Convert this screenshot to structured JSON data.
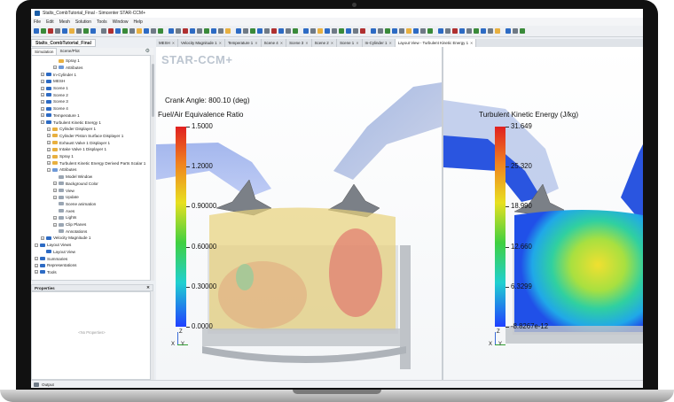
{
  "window": {
    "title": "Stalts_CombTutorial_Final - Simcenter STAR-CCM+"
  },
  "menu": [
    "File",
    "Edit",
    "Mesh",
    "Solution",
    "Tools",
    "Window",
    "Help"
  ],
  "left_panel": {
    "tabs": [
      "Stalts_CombTutorial_Final"
    ],
    "subtabs": [
      "Simulation",
      "Scene/Plot"
    ],
    "tree": [
      {
        "label": "Spray 1",
        "depth": 2,
        "exp": "",
        "icon": "#e8b040"
      },
      {
        "label": "Attributes",
        "depth": 2,
        "exp": "+",
        "icon": "#6f9ad8"
      },
      {
        "label": "In-Cylinder 1",
        "depth": 0,
        "exp": "+",
        "icon": "#2d6bc4"
      },
      {
        "label": "MESH",
        "depth": 0,
        "exp": "+",
        "icon": "#2d6bc4"
      },
      {
        "label": "Scene 1",
        "depth": 0,
        "exp": "+",
        "icon": "#2d6bc4"
      },
      {
        "label": "Scene 2",
        "depth": 0,
        "exp": "+",
        "icon": "#2d6bc4"
      },
      {
        "label": "Scene 3",
        "depth": 0,
        "exp": "+",
        "icon": "#2d6bc4"
      },
      {
        "label": "Scene 4",
        "depth": 0,
        "exp": "+",
        "icon": "#2d6bc4"
      },
      {
        "label": "Temperature 1",
        "depth": 0,
        "exp": "+",
        "icon": "#2d6bc4"
      },
      {
        "label": "Turbulent Kinetic Energy 1",
        "depth": 0,
        "exp": "−",
        "icon": "#2d6bc4"
      },
      {
        "label": "Cylinder Displayer 1",
        "depth": 1,
        "exp": "+",
        "icon": "#e8b040"
      },
      {
        "label": "Cylinder Piston Surface Displayer 1",
        "depth": 1,
        "exp": "+",
        "icon": "#e8b040"
      },
      {
        "label": "Exhaust Valve 1 Displayer 1",
        "depth": 1,
        "exp": "+",
        "icon": "#e8b040"
      },
      {
        "label": "Intake Valve 1 Displayer 1",
        "depth": 1,
        "exp": "+",
        "icon": "#e8b040"
      },
      {
        "label": "Spray 1",
        "depth": 1,
        "exp": "+",
        "icon": "#e8b040"
      },
      {
        "label": "Turbulent Kinetic Energy Derived Parts Scalar 1",
        "depth": 1,
        "exp": "+",
        "icon": "#e8b040"
      },
      {
        "label": "Attributes",
        "depth": 1,
        "exp": "−",
        "icon": "#6f9ad8"
      },
      {
        "label": "Model Window",
        "depth": 2,
        "exp": "",
        "icon": "#9aa6b3"
      },
      {
        "label": "Background Color",
        "depth": 2,
        "exp": "+",
        "icon": "#9aa6b3"
      },
      {
        "label": "View",
        "depth": 2,
        "exp": "+",
        "icon": "#9aa6b3"
      },
      {
        "label": "Update",
        "depth": 2,
        "exp": "+",
        "icon": "#9aa6b3"
      },
      {
        "label": "Scene animation",
        "depth": 2,
        "exp": "",
        "icon": "#9aa6b3"
      },
      {
        "label": "Axes",
        "depth": 2,
        "exp": "",
        "icon": "#9aa6b3"
      },
      {
        "label": "Lights",
        "depth": 2,
        "exp": "+",
        "icon": "#9aa6b3"
      },
      {
        "label": "Clip Planes",
        "depth": 2,
        "exp": "+",
        "icon": "#9aa6b3"
      },
      {
        "label": "Annotations",
        "depth": 2,
        "exp": "",
        "icon": "#9aa6b3"
      },
      {
        "label": "Velocity Magnitude 1",
        "depth": 0,
        "exp": "+",
        "icon": "#2d6bc4"
      },
      {
        "label": "Layout Views",
        "depth": -1,
        "exp": "−",
        "icon": "#2d6bc4"
      },
      {
        "label": "Layout View",
        "depth": 0,
        "exp": "",
        "icon": "#2d6bc4"
      },
      {
        "label": "Summaries",
        "depth": -1,
        "exp": "+",
        "icon": "#2d6bc4"
      },
      {
        "label": "Representations",
        "depth": -1,
        "exp": "+",
        "icon": "#2d6bc4"
      },
      {
        "label": "Tools",
        "depth": -1,
        "exp": "+",
        "icon": "#2d6bc4"
      }
    ],
    "properties": {
      "title": "Properties",
      "empty_text": "<No Properties>"
    }
  },
  "doc_tabs": [
    {
      "label": "MESH",
      "active": false
    },
    {
      "label": "Velocity Magnitude 1",
      "active": false
    },
    {
      "label": "Temperature 1",
      "active": false
    },
    {
      "label": "Scene 4",
      "active": false
    },
    {
      "label": "Scene 3",
      "active": false
    },
    {
      "label": "Scene 2",
      "active": false
    },
    {
      "label": "Scene 1",
      "active": false
    },
    {
      "label": "In-Cylinder 1",
      "active": false
    },
    {
      "label": "Layout View - Turbulent Kinetic Energy 1",
      "active": true
    }
  ],
  "viewports": {
    "left": {
      "logo": "STAR-CCM+",
      "crank_angle": "Crank Angle:  800.10 (deg)",
      "colorbar_title": "Fuel/Air Equivalence Ratio",
      "colorbar_labels": [
        "1.5000",
        "1.2000",
        "0.90000",
        "0.60000",
        "0.30000",
        "0.0000"
      ]
    },
    "right": {
      "colorbar_title": "Turbulent Kinetic Energy (J/kg)",
      "colorbar_labels": [
        "31.649",
        "25.320",
        "18.990",
        "12.660",
        "6.3299",
        "-8.8267e-12"
      ]
    },
    "axes": {
      "x": "X",
      "y": "Y",
      "z": "Z"
    }
  },
  "status": {
    "output_label": "Output"
  },
  "colors": {
    "accent": "#2d6bc4",
    "frame": "#111111"
  }
}
